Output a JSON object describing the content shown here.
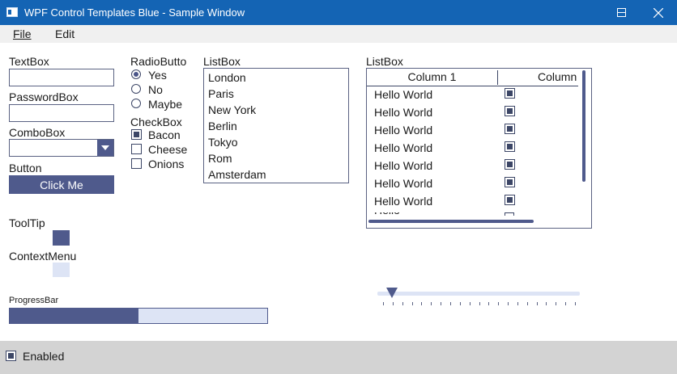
{
  "window": {
    "title": "WPF Control Templates Blue - Sample Window"
  },
  "menu": [
    {
      "label": "File"
    },
    {
      "label": "Edit"
    }
  ],
  "textbox": {
    "label": "TextBox",
    "value": ""
  },
  "passwordbox": {
    "label": "PasswordBox",
    "value": ""
  },
  "combobox": {
    "label": "ComboBox",
    "selected": ""
  },
  "button": {
    "label": "Button",
    "text": "Click Me"
  },
  "tooltip": {
    "label": "ToolTip"
  },
  "contextmenu": {
    "label": "ContextMenu"
  },
  "radio": {
    "label": "RadioButto",
    "options": [
      {
        "label": "Yes",
        "checked": true
      },
      {
        "label": "No",
        "checked": false
      },
      {
        "label": "Maybe",
        "checked": false
      }
    ]
  },
  "checkbox": {
    "label": "CheckBox",
    "options": [
      {
        "label": "Bacon",
        "checked": true
      },
      {
        "label": "Cheese",
        "checked": false
      },
      {
        "label": "Onions",
        "checked": false
      }
    ]
  },
  "listbox": {
    "label": "ListBox",
    "items": [
      "London",
      "Paris",
      "New York",
      "Berlin",
      "Tokyo",
      "Rom",
      "Amsterdam"
    ]
  },
  "gridlist": {
    "label": "ListBox",
    "columns": [
      "Column 1",
      "Column"
    ],
    "rows": [
      {
        "text": "Hello World",
        "checked": true
      },
      {
        "text": "Hello World",
        "checked": true
      },
      {
        "text": "Hello World",
        "checked": true
      },
      {
        "text": "Hello World",
        "checked": true
      },
      {
        "text": "Hello World",
        "checked": true
      },
      {
        "text": "Hello World",
        "checked": true
      },
      {
        "text": "Hello World",
        "checked": true
      }
    ]
  },
  "progress": {
    "label": "ProgressBar",
    "value_fraction": 0.5
  },
  "slider": {
    "value_fraction": 0.0,
    "tick_count": 21
  },
  "footer": {
    "enabled_label": "Enabled",
    "enabled_checked": true
  },
  "colors": {
    "titlebar": "#1464b4",
    "accent": "#4f5a8c",
    "accent_light": "#dde4f5",
    "footer": "#d3d3d3"
  }
}
